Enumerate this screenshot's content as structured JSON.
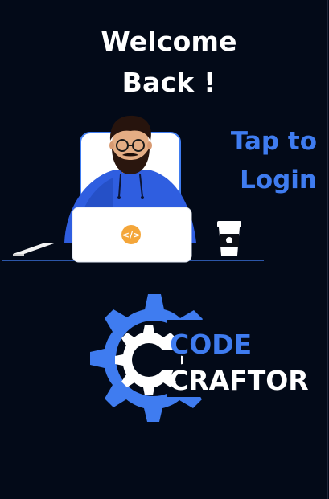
{
  "header": {
    "welcome_line1": "Welcome",
    "welcome_line2": "Back !"
  },
  "login": {
    "tap_line1": "Tap to",
    "tap_line2": "Login"
  },
  "illustration": {
    "laptop_icon": "code-brackets-icon",
    "items": [
      "developer-person",
      "laptop",
      "phone",
      "coffee-cup"
    ]
  },
  "logo": {
    "line1": "CODE",
    "line2": "CRAFTOR",
    "icon": "gear-icon"
  },
  "colors": {
    "background": "#030a18",
    "accent": "#3f7cf0",
    "text": "#ffffff",
    "laptop_badge": "#f4a63a"
  }
}
